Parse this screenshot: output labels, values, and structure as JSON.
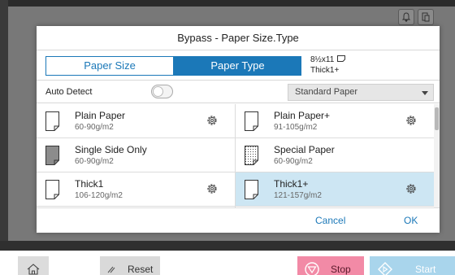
{
  "dialog": {
    "title": "Bypass - Paper Size.Type",
    "tabs": [
      {
        "label": "Paper Size",
        "active": false
      },
      {
        "label": "Paper Type",
        "active": true
      }
    ],
    "current": {
      "size": "8½x11",
      "type": "Thick1+",
      "orientation_icon": "landscape-paper-icon"
    },
    "auto_detect": {
      "label": "Auto Detect",
      "enabled": false
    },
    "filter": {
      "selected": "Standard Paper"
    },
    "paper_types": [
      {
        "name": "Plain Paper",
        "weight": "60-90g/m2",
        "settings": true,
        "selected": false,
        "icon": "plain-paper-icon"
      },
      {
        "name": "Plain Paper+",
        "weight": "91-105g/m2",
        "settings": true,
        "selected": false,
        "icon": "plain-paper-icon"
      },
      {
        "name": "Single Side Only",
        "weight": "60-90g/m2",
        "settings": false,
        "selected": false,
        "icon": "single-side-paper-icon"
      },
      {
        "name": "Special Paper",
        "weight": "60-90g/m2",
        "settings": false,
        "selected": false,
        "icon": "special-paper-icon"
      },
      {
        "name": "Thick1",
        "weight": "106-120g/m2",
        "settings": true,
        "selected": false,
        "icon": "plain-paper-icon"
      },
      {
        "name": "Thick1+",
        "weight": "121-157g/m2",
        "settings": true,
        "selected": true,
        "icon": "plain-paper-icon"
      }
    ],
    "buttons": {
      "cancel": "Cancel",
      "ok": "OK"
    }
  },
  "bottom_bar": {
    "reset": "Reset",
    "stop": "Stop",
    "start": "Start"
  },
  "colors": {
    "accent": "#1b78b8",
    "selected_row": "#cde6f3",
    "stop": "#f28aa6",
    "start": "#a9d5ec"
  }
}
